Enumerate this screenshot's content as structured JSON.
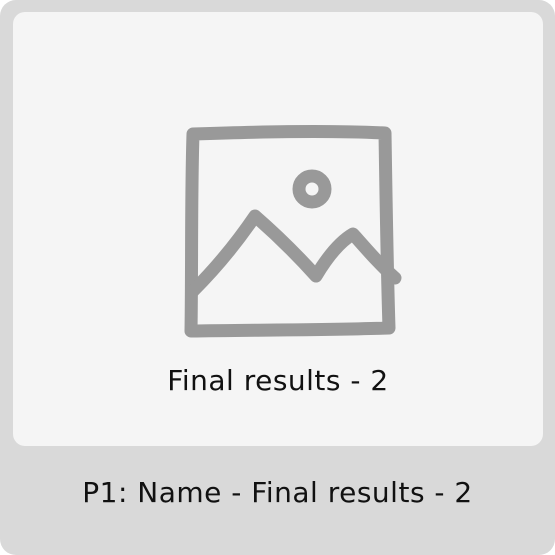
{
  "card": {
    "preview": {
      "icon": "image-placeholder-icon",
      "caption": "Final results - 2"
    },
    "title": "P1: Name - Final results - 2"
  },
  "colors": {
    "card_background": "#d9d9d9",
    "preview_background": "#f5f5f5",
    "icon_stroke": "#999999",
    "text": "#111111"
  }
}
